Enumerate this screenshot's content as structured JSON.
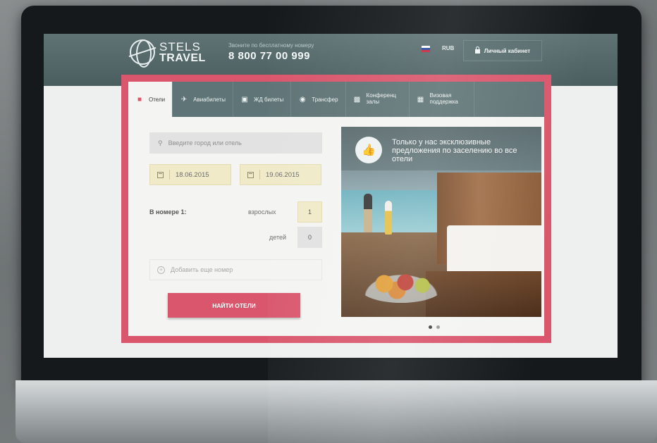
{
  "header": {
    "logo_line1": "STELS",
    "logo_line2": "TRAVEL",
    "phone_caption": "Звоните по бесплатному номеру",
    "phone_number": "8 800 77 00 999",
    "currency": "RUB",
    "cabinet_label": "Личный кабинет"
  },
  "tabs": [
    {
      "label": "Отели",
      "icon": "bed-icon",
      "active": true
    },
    {
      "label": "Авиабилеты",
      "icon": "plane-icon"
    },
    {
      "label": "ЖД билеты",
      "icon": "train-icon"
    },
    {
      "label": "Трансфер",
      "icon": "globe-icon"
    },
    {
      "label": "Конференц залы",
      "icon": "screen-icon"
    },
    {
      "label": "Визовая поддержка",
      "icon": "passport-icon"
    }
  ],
  "search": {
    "placeholder": "Введите город или отель"
  },
  "dates": {
    "checkin": "18.06.2015",
    "checkout": "19.06.2015"
  },
  "room": {
    "label": "В номере 1:",
    "adults_label": "взрослых",
    "adults_value": "1",
    "kids_label": "детей",
    "kids_value": "0",
    "add_room": "Добавить еще номер"
  },
  "find_button": "НАЙТИ ОТЕЛИ",
  "promo": {
    "text": "Только у нас эксклюзивные предложения по заселению во все отели",
    "icon": "thumbs-up-icon"
  },
  "slider": {
    "dots": 2,
    "active_index": 0
  },
  "colors": {
    "accent": "#d9566c",
    "header": "#5f7476",
    "date_fill": "#f0eac9"
  }
}
